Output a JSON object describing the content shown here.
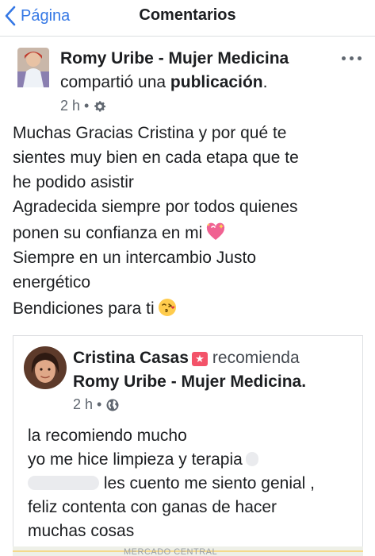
{
  "nav": {
    "back_label": "Página",
    "title": "Comentarios"
  },
  "post": {
    "author": "Romy Uribe - Mujer Medicina",
    "action_prefix": "compartió una ",
    "action_object": "publicación",
    "action_suffix": ".",
    "time": "2 h",
    "privacy_icon": "gear-icon",
    "body_lines": [
      "Muchas Gracias Cristina y por qué te",
      "sientes muy bien en cada etapa que te",
      "he podido asistir",
      "Agradecida siempre por todos quienes",
      "ponen su confianza en mi",
      "Siempre en un intercambio Justo",
      "energético",
      "Bendiciones para ti"
    ],
    "emojis": [
      "sparkling-heart-icon",
      "face-blowing-kiss-icon"
    ]
  },
  "shared": {
    "author": "Cristina Casas",
    "badge_icon": "recommend-badge-icon",
    "verb": "recomienda",
    "page": "Romy Uribe - Mujer Medicina.",
    "time": "2 h",
    "privacy_icon": "globe-icon",
    "lines": [
      "la recomiendo mucho",
      "yo me hice limpieza y terapia",
      "les cuento me siento genial ,",
      "feliz contenta con ganas de hacer",
      "muchas cosas"
    ]
  },
  "map": {
    "label": "MERCADO CENTRAL"
  },
  "colors": {
    "link_blue": "#3578e5",
    "text": "#1c1e21",
    "secondary": "#606770",
    "badge": "#f35369"
  }
}
